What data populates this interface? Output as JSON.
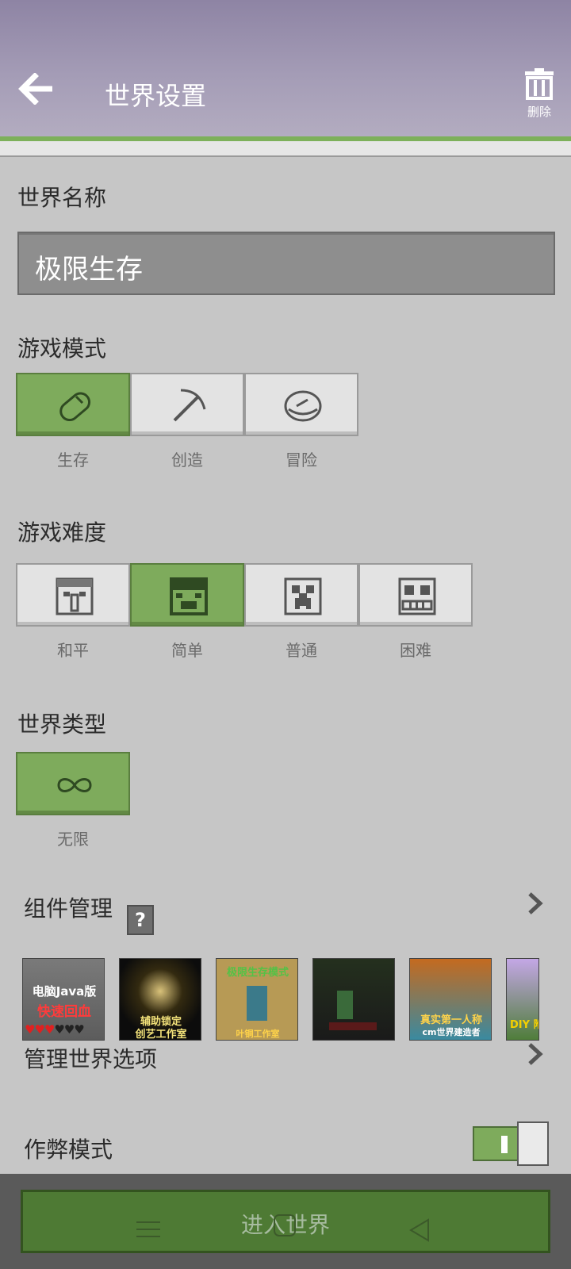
{
  "header": {
    "title": "世界设置",
    "delete_label": "删除"
  },
  "world_name": {
    "label": "世界名称",
    "value": "极限生存"
  },
  "game_mode": {
    "label": "游戏模式",
    "options": [
      {
        "label": "生存",
        "icon": "bread-icon",
        "selected": true
      },
      {
        "label": "创造",
        "icon": "pickaxe-icon",
        "selected": false
      },
      {
        "label": "冒险",
        "icon": "compass-icon",
        "selected": false
      }
    ]
  },
  "difficulty": {
    "label": "游戏难度",
    "options": [
      {
        "label": "和平",
        "icon": "villager-face-icon",
        "selected": false
      },
      {
        "label": "简单",
        "icon": "pig-face-icon",
        "selected": true
      },
      {
        "label": "普通",
        "icon": "creeper-face-icon",
        "selected": false
      },
      {
        "label": "困难",
        "icon": "skeleton-face-icon",
        "selected": false
      }
    ]
  },
  "world_type": {
    "label": "世界类型",
    "options": [
      {
        "label": "无限",
        "icon": "infinity-icon",
        "selected": true
      }
    ]
  },
  "addons": {
    "label": "组件管理",
    "help": "?",
    "thumbs": [
      {
        "lines": [
          "电脑Java版",
          "快速回血"
        ]
      },
      {
        "lines": [
          "辅助锁定",
          "创艺工作室"
        ]
      },
      {
        "lines": [
          "极限生存模式",
          "叶铜工作室"
        ]
      },
      {
        "lines": []
      },
      {
        "lines": [
          "真实第一人称",
          "cm世界建造者"
        ]
      },
      {
        "lines": [
          "DIY 附"
        ]
      }
    ]
  },
  "manage_options": {
    "label": "管理世界选项"
  },
  "cheats": {
    "label": "作弊模式",
    "enabled": true
  },
  "enter_button": {
    "label": "进入世界"
  },
  "colors": {
    "accent_green": "#7eab5c",
    "button_dark_green": "#4e7a34"
  }
}
